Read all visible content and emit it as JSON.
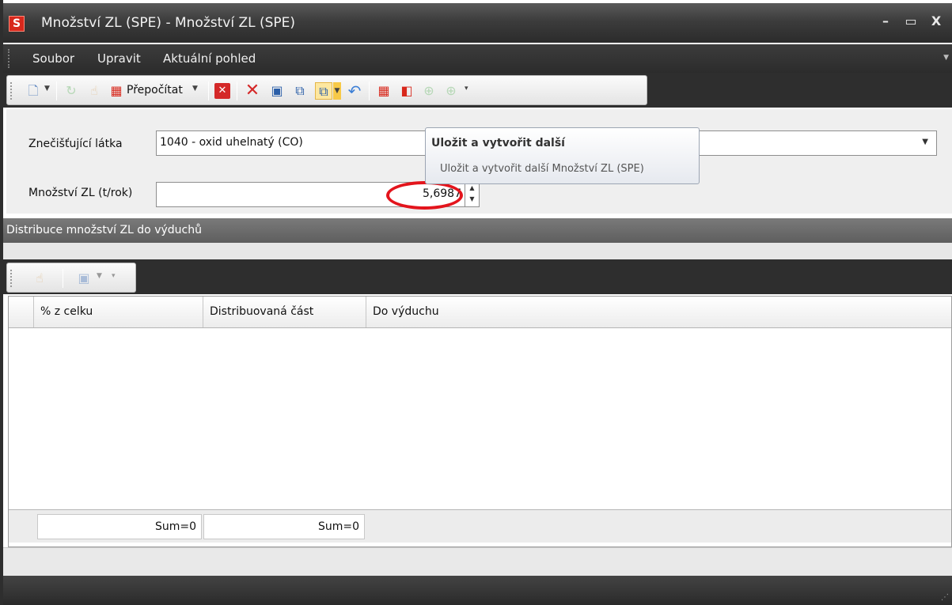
{
  "window": {
    "title": "Množství ZL (SPE) - Množství ZL (SPE)",
    "app_icon": "S",
    "controls": {
      "minimize": "–",
      "maximize": "▭",
      "close": "X"
    }
  },
  "menu": {
    "items": [
      "Soubor",
      "Upravit",
      "Aktuální pohled"
    ]
  },
  "toolbar": {
    "recalc_label": "Přepočítat",
    "icons": [
      "new-doc-icon",
      "refresh-icon",
      "hand-icon",
      "calculator-icon",
      "delete-red-icon",
      "close-x-icon",
      "save-icon",
      "save-close-icon",
      "save-new-icon",
      "undo-icon",
      "report-icon",
      "export-icon",
      "up-icon",
      "down-icon"
    ]
  },
  "form": {
    "substance_label": "Znečišťující látka",
    "substance_value": "1040 - oxid uhelnatý (CO)",
    "amount_label": "Množství ZL (t/rok)",
    "amount_value": "5,6987"
  },
  "tooltip": {
    "title": "Uložit a vytvořit další",
    "description": "Uložit a vytvořit další Množství ZL (SPE)"
  },
  "section": {
    "title": "Distribuce množství ZL do výduchů"
  },
  "grid": {
    "columns": [
      "% z celku",
      "Distribuovaná část",
      "Do výduchu"
    ],
    "rows": [],
    "footer": [
      "Sum=0",
      "Sum=0"
    ]
  },
  "colors": {
    "highlight": "#e3141c",
    "titlebar": "#3c3c3c"
  }
}
